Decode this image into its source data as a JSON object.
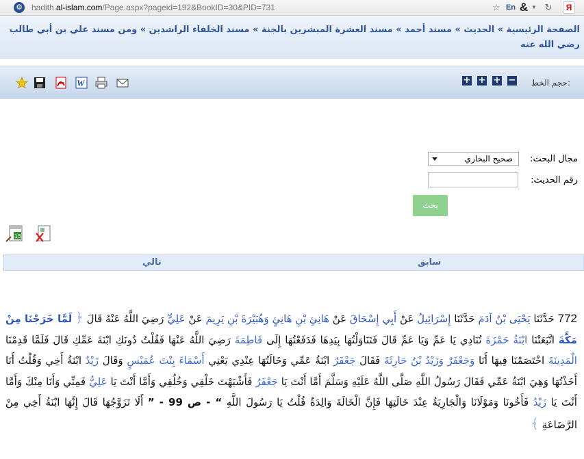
{
  "browser": {
    "url_prefix": "hadith.",
    "url_domain": "al-islam.com",
    "url_path": "/Page.aspx?pageid=192&BookID=30&PID=731",
    "star_icon": "star-outline-icon",
    "lang_badge": "En",
    "amp_glyph": "&",
    "dropdown_glyph": "▼",
    "reload_glyph": "C",
    "yandex_badge": "Я"
  },
  "breadcrumb": {
    "items": [
      "الصفحة الرئيسية",
      "الحديث",
      "مسند أحمد",
      "مسند العشرة المبشرين بالجنة",
      "مسند الخلفاء الراشدين",
      "ومن مسند علي بن أبي طالب رضي الله عنه"
    ],
    "sep": "»"
  },
  "toolbar": {
    "font_size_label": "حجم الخط:",
    "minus": "−",
    "plus": "+",
    "icons": [
      "favorite-star-icon",
      "save-disk-icon",
      "pdf-icon",
      "word-icon",
      "print-icon",
      "email-icon"
    ]
  },
  "search": {
    "field_label": "مجال البحث:",
    "field_value": "صحيح البخاري",
    "number_label": "رقم الحديث:",
    "number_value": "",
    "submit_label": "بحث"
  },
  "nav": {
    "prev": "سابق",
    "next": "تالي"
  },
  "hadith": {
    "number": "772",
    "p1": "حَدَّثَنَا",
    "n1": "يَحْيَى بْنُ آدَمَ",
    "p2": "حَدَّثَنَا",
    "n2": "إِسْرَائِيلُ",
    "p3": "عَنْ",
    "n3": "أَبِي إِسْحَاقَ",
    "p4": "عَنْ",
    "n4": "هَانِئِ بْنِ هَانِئٍ",
    "n5": "وَهُبَيْرَةَ بْنِ يَرِيمَ",
    "p5": "عَنْ",
    "n6": "عَلِيٍّ",
    "p6": "رَضِيَ اللَّهُ عَنْهُ قَالَ",
    "open_quote": "لَمَّا خَرَجْنَا مِنْ مَكَّةَ",
    "t1": "اتَّبَعَتْنَا",
    "g1": "ابْنَةُ حَمْزَةَ",
    "t2": "تُنَادِي يَا عَمِّ وَيَا عَمِّ قَالَ فَتَنَاوَلْتُهَا بِيَدِهَا فَدَفَعْتُهَا إِلَى",
    "g2": "فَاطِمَةَ",
    "t3": "رَضِيَ اللَّهُ عَنْهَا فَقُلْتُ دُونَكِ ابْنَةَ عَمِّكِ قَالَ فَلَمَّا قَدِمْنَا",
    "g3": "الْمَدِينَةَ",
    "t4": "اخْتَصَمْنَا فِيهَا أَنَا",
    "g4": "وَجَعْفَرٌ وَزَيْدُ بْنُ حَارِثَةَ",
    "t5": "فَقَالَ",
    "g5": "جَعْفَرٌ",
    "t6": "ابْنَةُ عَمِّي وَخَالَتُهَا عِنْدِي يَعْنِي",
    "g6": "أَسْمَاءَ بِنْتَ عُمَيْسٍ",
    "t7": "وَقَالَ",
    "g7": "زَيْدٌ",
    "t8": "ابْنَةُ أَخِي وَقُلْتُ أَنَا أَخَذْتُهَا وَهِيَ ابْنَةُ عَمِّي فَقَالَ رَسُولُ اللَّهِ صَلَّى اللَّهُ عَلَيْهِ وَسَلَّمَ أَمَّا أَنْتَ يَا",
    "g8": "جَعْفَرُ",
    "t9": "فَأَشْبَهْتَ خَلْقِي وَخُلُقِي وَأَمَّا أَنْتَ يَا",
    "g9": "عَلِيُّ",
    "t10": "فَمِنِّي وَأَنَا مِنْكَ وَأَمَّا أَنْتَ يَا",
    "g10": "زَيْدُ",
    "t11": "فَأَخُونَا وَمَوْلَانَا وَالْجَارِيَةُ عِنْدَ خَالَتِهَا فَإِنَّ الْخَالَةَ وَالِدَةٌ قُلْتُ يَا رَسُولَ اللَّهِ",
    "page_ref": "“ - ص 99 - ”",
    "t12": "أَلَا تَزَوَّجُهَا قَالَ إِنَّهَا ابْنَةُ أَخِي مِنْ الرَّضَاعَةِ",
    "close_mark": "﴾",
    "open_mark": "﴿"
  },
  "colors": {
    "accent": "#2f5596",
    "link": "#2f56b8",
    "button": "#8fd18f",
    "toolbar_square": "#1f3b6c"
  }
}
